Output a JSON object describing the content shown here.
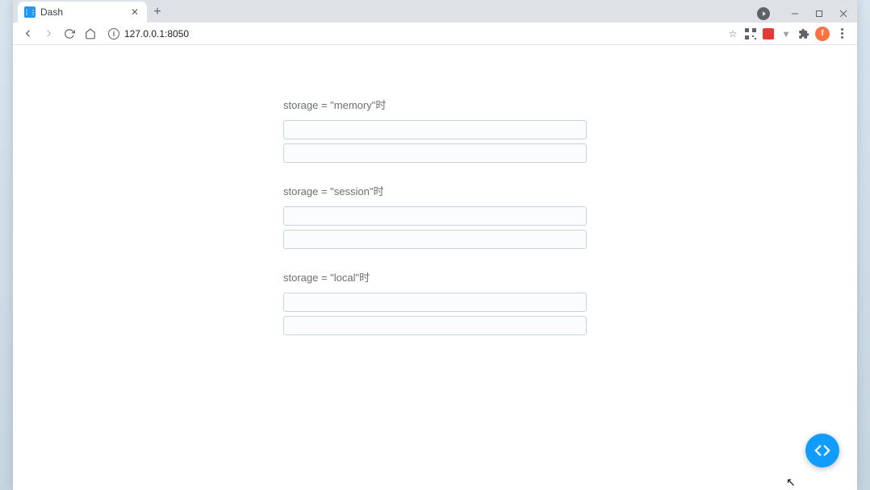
{
  "browser": {
    "tab_title": "Dash",
    "url": "127.0.0.1:8050",
    "avatar_initial": "f"
  },
  "page": {
    "sections": [
      {
        "label": "storage = \"memory\"时"
      },
      {
        "label": "storage = \"session\"时"
      },
      {
        "label": "storage = \"local\"时"
      }
    ]
  }
}
